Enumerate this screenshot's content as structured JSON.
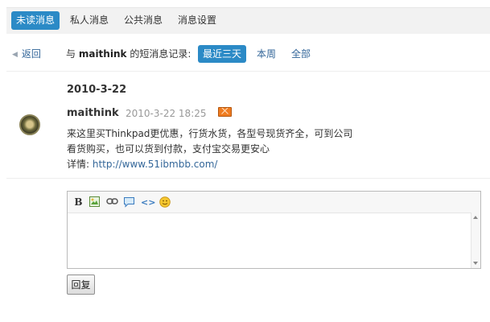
{
  "tabs": [
    {
      "label": "未读消息",
      "active": true
    },
    {
      "label": "私人消息",
      "active": false
    },
    {
      "label": "公共消息",
      "active": false
    },
    {
      "label": "消息设置",
      "active": false
    }
  ],
  "filter_bar": {
    "back_label": "返回",
    "prefix": "与",
    "username": "maithink",
    "suffix": "的短消息记录:",
    "ranges": [
      {
        "label": "最近三天",
        "active": true
      },
      {
        "label": "本周",
        "active": false
      },
      {
        "label": "全部",
        "active": false
      }
    ]
  },
  "conversation": {
    "date": "2010-3-22",
    "message": {
      "sender": "maithink",
      "time": "2010-3-22 18:25",
      "icon": "envelope-icon",
      "lines": [
        "来这里买Thinkpad更优惠，行货水货，各型号现货齐全，可到公司",
        "看货购买，也可以货到付款，支付宝交易更安心"
      ],
      "detail_label": "详情:",
      "detail_link": "http://www.51ibmbb.com/"
    }
  },
  "editor": {
    "toolbar": [
      {
        "name": "bold-button-icon",
        "glyph": "B"
      },
      {
        "name": "image-icon",
        "glyph": ""
      },
      {
        "name": "link-icon",
        "glyph": ""
      },
      {
        "name": "quote-icon",
        "glyph": ""
      },
      {
        "name": "code-icon",
        "glyph": "<>"
      },
      {
        "name": "smiley-icon",
        "glyph": ""
      }
    ],
    "value": ""
  },
  "reply_button_label": "回复",
  "colors": {
    "accent": "#2b8ac6",
    "link": "#336699",
    "mail_icon": "#f07b1f"
  }
}
